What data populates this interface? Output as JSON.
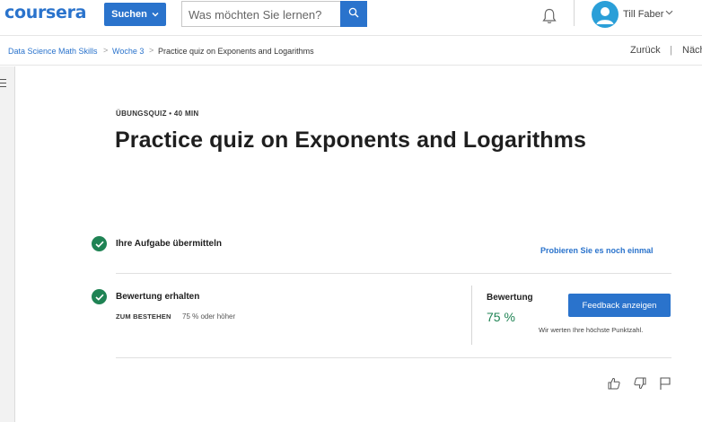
{
  "header": {
    "logo": "coursera",
    "explore_label": "Suchen",
    "search_placeholder": "Was möchten Sie lernen?",
    "user_name": "Till Faber",
    "brand_color": "#2a73cc",
    "icons": [
      "chevron-down-icon",
      "search-icon",
      "bell-icon",
      "avatar-icon"
    ]
  },
  "breadcrumb": {
    "items": [
      "Data Science Math Skills",
      "Woche 3",
      "Practice quiz on Exponents and Logarithms"
    ],
    "separator": ">",
    "back_label": "Zurück",
    "nav_divider": "|",
    "next_label": "Näch"
  },
  "quiz": {
    "kicker": "ÜBUNGSQUIZ • 40 MIN",
    "title": "Practice quiz on Exponents and Logarithms",
    "step1": {
      "label": "Ihre Aufgabe übermitteln",
      "action": "Probieren Sie es noch einmal"
    },
    "step2": {
      "label": "Bewertung erhalten",
      "pass_label": "ZUM BESTEHEN",
      "pass_value": "75 % oder höher"
    },
    "grade": {
      "label": "Bewertung",
      "value": "75 %",
      "feedback_button": "Feedback anzeigen",
      "note": "Wir werten Ihre höchste Punktzahl."
    },
    "success_color": "#1f8354",
    "feedback_icons": [
      "thumbs-up-icon",
      "thumbs-down-icon",
      "flag-icon"
    ]
  }
}
